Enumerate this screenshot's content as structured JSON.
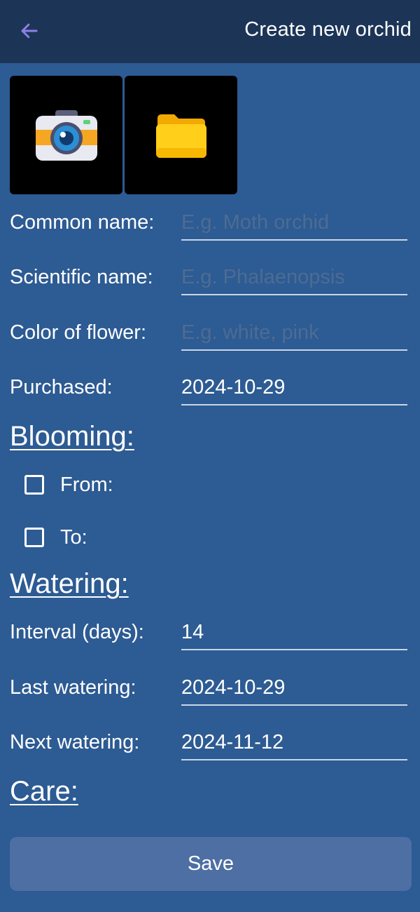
{
  "topbar": {
    "title": "Create new orchid",
    "back_icon": "arrow-left-icon",
    "accent_color": "#8f7ee8"
  },
  "image_sources": [
    {
      "icon": "camera-icon"
    },
    {
      "icon": "folder-icon"
    }
  ],
  "fields": {
    "common_name": {
      "label": "Common name:",
      "value": "",
      "placeholder": "E.g. Moth orchid"
    },
    "scientific_name": {
      "label": "Scientific name:",
      "value": "",
      "placeholder": "E.g. Phalaenopsis"
    },
    "flower_color": {
      "label": "Color of flower:",
      "value": "",
      "placeholder": "E.g. white, pink"
    },
    "purchased": {
      "label": "Purchased:",
      "value": "2024-10-29"
    }
  },
  "blooming": {
    "heading": "Blooming:",
    "from": {
      "label": "From:",
      "checked": false
    },
    "to": {
      "label": "To:",
      "checked": false
    }
  },
  "watering": {
    "heading": "Watering:",
    "interval": {
      "label": "Interval (days):",
      "value": "14"
    },
    "last": {
      "label": "Last watering:",
      "value": "2024-10-29"
    },
    "next": {
      "label": "Next watering:",
      "value": "2024-11-12"
    }
  },
  "care": {
    "heading": "Care:"
  },
  "save_button": {
    "label": "Save"
  },
  "colors": {
    "background": "#2d5b93",
    "topbar": "#1c3557",
    "button": "#4d6fa3"
  }
}
